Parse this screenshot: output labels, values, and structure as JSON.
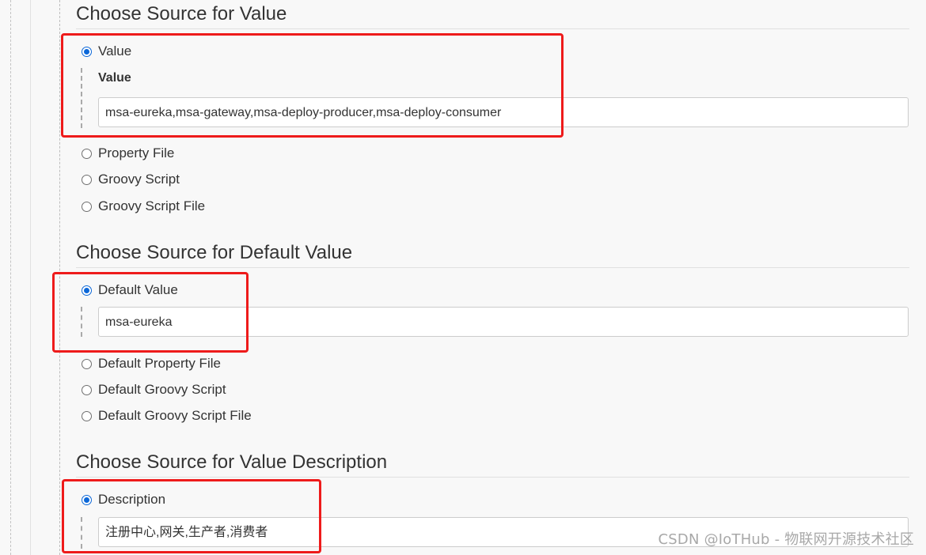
{
  "sections": [
    {
      "title": "Choose Source for Value",
      "selected_option": "Value",
      "sub_label": "Value",
      "input_value": "msa-eureka,msa-gateway,msa-deploy-producer,msa-deploy-consumer",
      "other_options": [
        "Property File",
        "Groovy Script",
        "Groovy Script File"
      ]
    },
    {
      "title": "Choose Source for Default Value",
      "selected_option": "Default Value",
      "input_value": "msa-eureka",
      "other_options": [
        "Default Property File",
        "Default Groovy Script",
        "Default Groovy Script File"
      ]
    },
    {
      "title": "Choose Source for Value Description",
      "selected_option": "Description",
      "input_value": "注册中心,网关,生产者,消费者"
    }
  ],
  "watermark": "CSDN @IoTHub - 物联网开源技术社区",
  "colors": {
    "accent": "#0b67d8",
    "highlight": "#ee1b1b",
    "background": "#f8f8f8"
  }
}
